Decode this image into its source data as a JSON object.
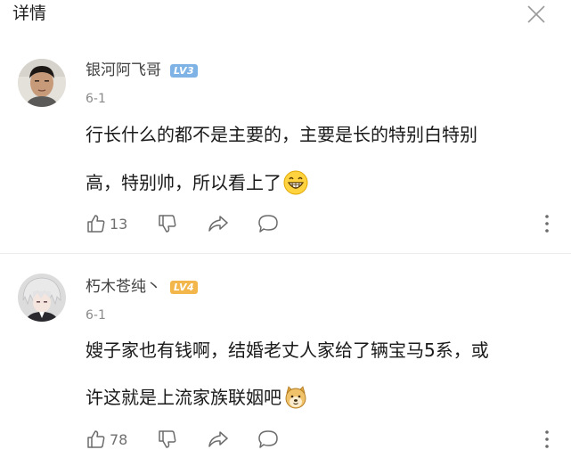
{
  "header": {
    "title": "详情"
  },
  "comments": [
    {
      "username": "银河阿飞哥",
      "level": "LV3",
      "level_color": "#7fb3e6",
      "date": "6-1",
      "lines": [
        "行长什么的都不是主要的，主要是长的特别白特别",
        "高，特别帅，所以看上了"
      ],
      "emoji": "grinning-face-emoji",
      "likes": "13"
    },
    {
      "username": "朽木苍纯丶",
      "level": "LV4",
      "level_color": "#f2b64a",
      "date": "6-1",
      "lines": [
        "嫂子家也有钱啊，结婚老丈人家给了辆宝马5系，或",
        "许这就是上流家族联姻吧"
      ],
      "emoji": "doge-emoji",
      "likes": "78"
    }
  ],
  "colors": {
    "divider": "#ececec",
    "icon": "#6b6b6b"
  }
}
